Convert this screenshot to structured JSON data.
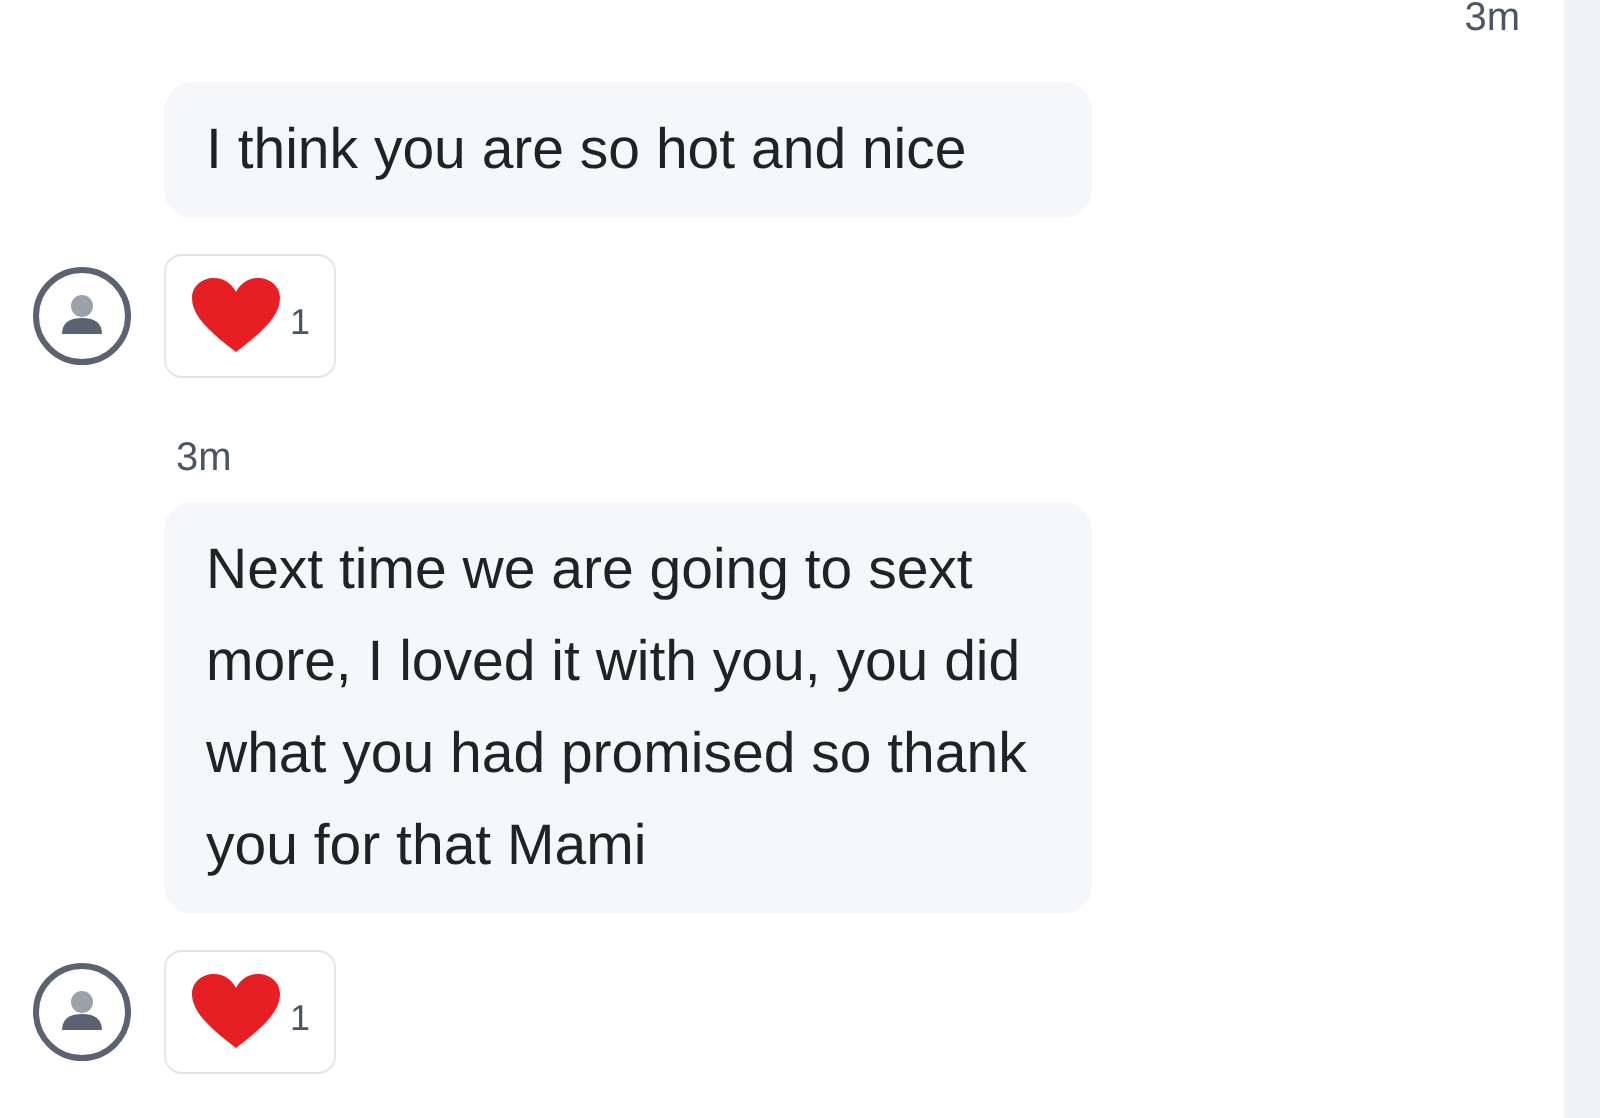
{
  "thread": [
    {
      "kind": "time",
      "text": "3m",
      "align_end": true
    },
    {
      "kind": "message",
      "text": "I think you are so hot and nice",
      "reaction_count": "1"
    },
    {
      "kind": "time",
      "text": "3m",
      "align_end": false
    },
    {
      "kind": "message",
      "text": "Next time we are going to sext more, I loved it with you, you did what you had promised so thank you for that Mami",
      "reaction_count": "1"
    }
  ]
}
